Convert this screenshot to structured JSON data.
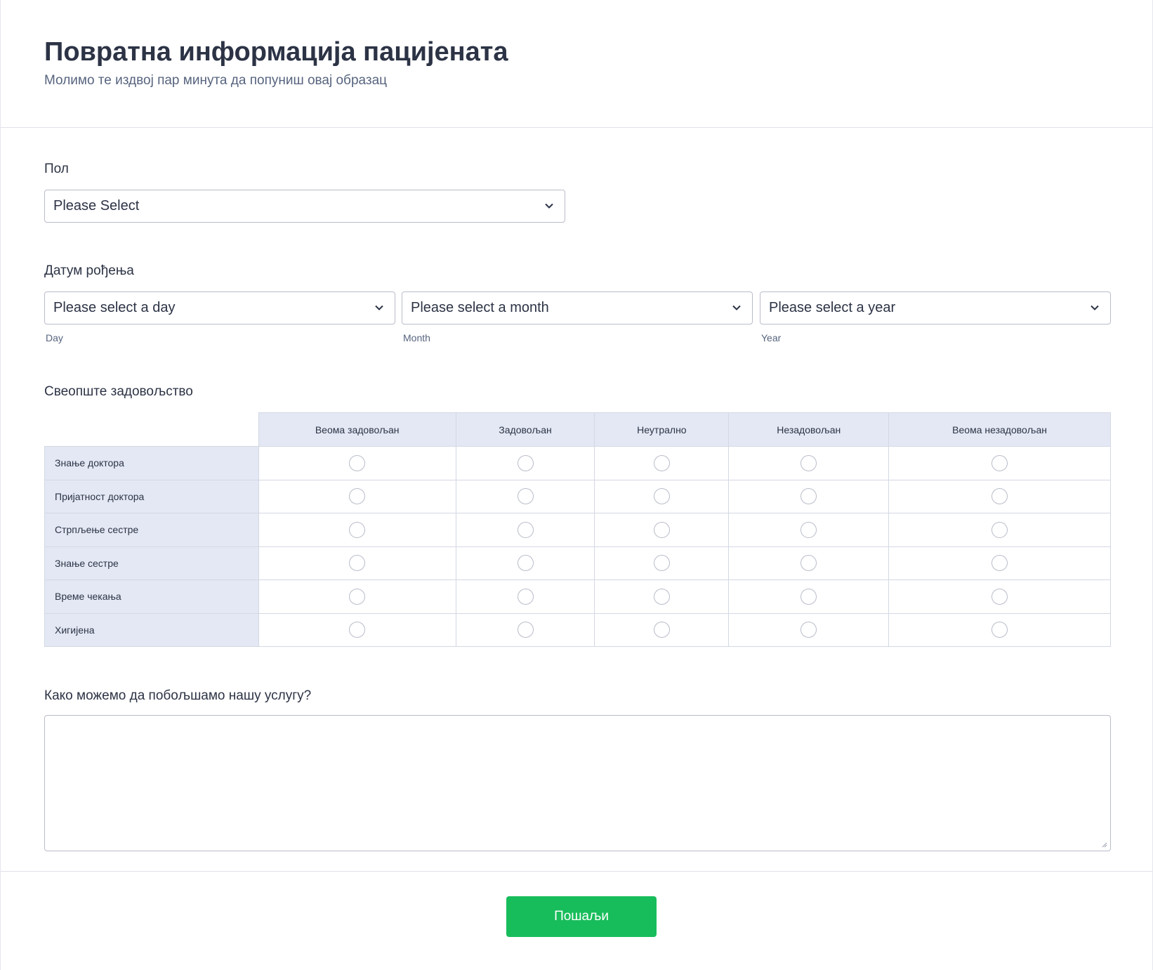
{
  "header": {
    "title": "Повратна информација пацијената",
    "subtitle": "Молимо те издвој пар минута да попуниш овај образац"
  },
  "gender": {
    "label": "Пол",
    "select_value": "Please Select"
  },
  "dob": {
    "label": "Датум рођења",
    "day": {
      "value": "Please select a day",
      "sublabel": "Day"
    },
    "month": {
      "value": "Please select a month",
      "sublabel": "Month"
    },
    "year": {
      "value": "Please select a year",
      "sublabel": "Year"
    }
  },
  "satisfaction": {
    "label": "Свеопште задовољство",
    "columns": [
      "Веома задовољан",
      "Задовољан",
      "Неутрално",
      "Незадовољан",
      "Веома незадовољан"
    ],
    "rows": [
      "Знање доктора",
      "Пријатност доктора",
      "Стрпљење сестре",
      "Знање сестре",
      "Време чекања",
      "Хигијена"
    ]
  },
  "improve": {
    "label": "Како можемо да побољшамо нашу услугу?",
    "value": ""
  },
  "submit": {
    "label": "Пошаљи"
  },
  "colors": {
    "accent": "#18bd5b",
    "header_cell": "#e3e8f4",
    "border": "#b8bdc9"
  }
}
